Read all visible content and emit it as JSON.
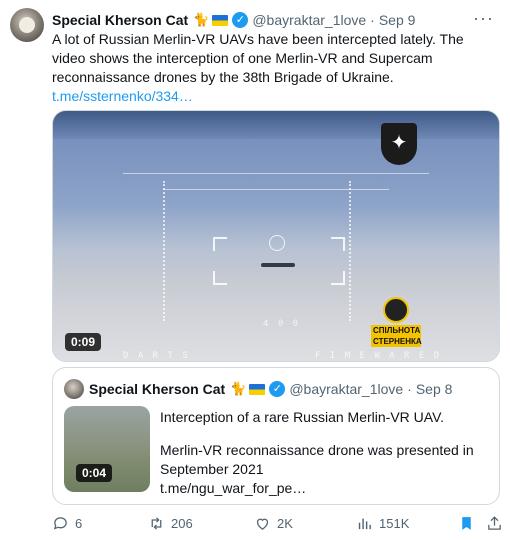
{
  "tweet": {
    "author_name": "Special Kherson Cat",
    "author_emoji": "🐈",
    "handle": "@bayraktar_1love",
    "separator": "·",
    "date": "Sep 9",
    "more": "···",
    "text": "A lot of Russian Merlin-VR UAVs have been intercepted lately. The video shows the interception of one Merlin-VR and Supercam reconnaissance drones by the 38th Brigade of Ukraine.",
    "link": "t.me/ssternenko/334…",
    "video": {
      "duration": "0:09",
      "overlay_badge_line1": "СПІЛЬНОТА",
      "overlay_badge_line2": "СТЕРНЕНКА",
      "hud_left": "D A R T S",
      "hud_right": "F I M E  W A R E D",
      "hud_mid": "4 0 0"
    }
  },
  "quote": {
    "author_name": "Special Kherson Cat",
    "author_emoji": "🐈",
    "handle": "@bayraktar_1love",
    "separator": "·",
    "date": "Sep 8",
    "line1": "Interception of a rare Russian Merlin-VR UAV.",
    "line2": "Merlin-VR reconnaissance drone was presented in September 2021",
    "link": "t.me/ngu_war_for_pe…",
    "thumb_duration": "0:04"
  },
  "actions": {
    "replies": "6",
    "retweets": "206",
    "likes": "2K",
    "views": "151K"
  },
  "colors": {
    "accent": "#1d9bf0",
    "muted": "#536471",
    "border": "#cfd9de"
  },
  "icons": [
    "verified-icon",
    "reply-icon",
    "retweet-icon",
    "like-icon",
    "views-icon",
    "bookmark-icon",
    "share-icon",
    "more-icon"
  ]
}
